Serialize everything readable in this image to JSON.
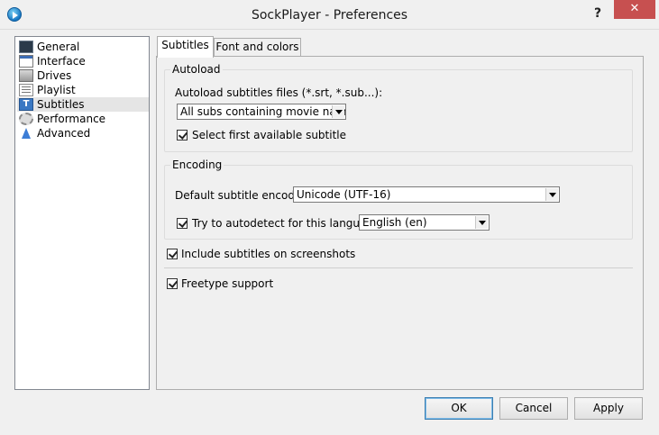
{
  "window": {
    "title": "SockPlayer - Preferences",
    "help_glyph": "?",
    "close_glyph": "✕"
  },
  "sidebar": {
    "items": [
      {
        "label": "General",
        "icon": "monitor-icon"
      },
      {
        "label": "Interface",
        "icon": "window-icon"
      },
      {
        "label": "Drives",
        "icon": "drive-icon"
      },
      {
        "label": "Playlist",
        "icon": "list-icon"
      },
      {
        "label": "Subtitles",
        "icon": "subtitles-icon",
        "selected": true
      },
      {
        "label": "Performance",
        "icon": "gear-icon"
      },
      {
        "label": "Advanced",
        "icon": "flask-icon"
      }
    ]
  },
  "tabs": [
    {
      "label": "Subtitles",
      "active": true
    },
    {
      "label": "Font and colors",
      "active": false
    }
  ],
  "autoload": {
    "title": "Autoload",
    "files_label": "Autoload subtitles files (*.srt, *.sub...):",
    "files_value": "All subs containing movie name",
    "select_first_label": "Select first available subtitle",
    "select_first_checked": true
  },
  "encoding": {
    "title": "Encoding",
    "default_label": "Default subtitle encoding:",
    "default_value": "Unicode (UTF-16)",
    "autodetect_label": "Try to autodetect for this language:",
    "autodetect_checked": true,
    "language_value": "English (en)"
  },
  "options": {
    "screenshots_label": "Include subtitles on screenshots",
    "screenshots_checked": true,
    "freetype_label": "Freetype support",
    "freetype_checked": true
  },
  "buttons": {
    "ok": "OK",
    "cancel": "Cancel",
    "apply": "Apply"
  },
  "colors": {
    "close_button": "#c75050",
    "selection": "#e5e5e5",
    "default_button_border": "#3c7fb1"
  }
}
